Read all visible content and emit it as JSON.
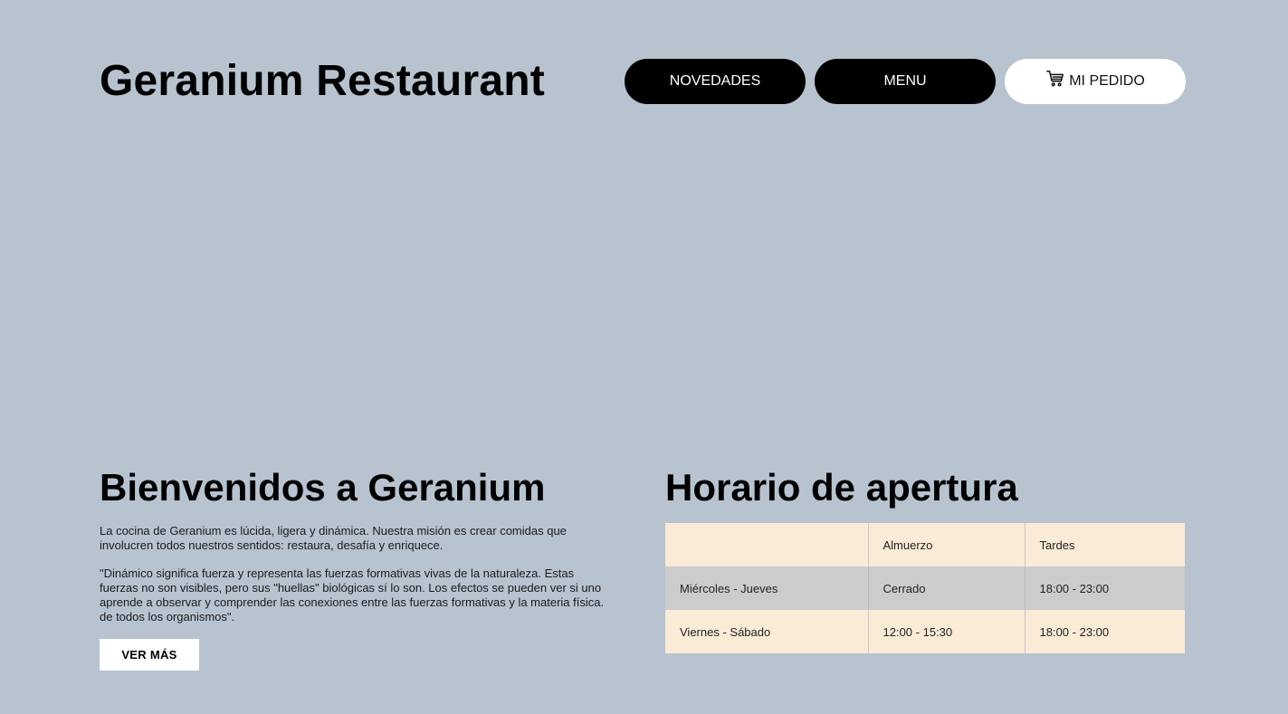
{
  "header": {
    "title": "Geranium Restaurant",
    "nav": {
      "news_label": "NOVEDADES",
      "menu_label": "MENU",
      "order_label": "MI PEDIDO",
      "order_icon": "cart-icon"
    }
  },
  "welcome": {
    "title": "Bienvenidos a Geranium",
    "paragraph1": "La cocina de Geranium es lúcida, ligera y dinámica. Nuestra misión es crear comidas que involucren todos nuestros sentidos: restaura, desafía y enriquece.",
    "paragraph2": "\"Dinámico significa fuerza y representa las fuerzas formativas vivas de la naturaleza. Estas fuerzas no son visibles, pero sus \"huellas\" biológicas sí lo son. Los efectos se pueden ver si uno aprende a observar y comprender las conexiones entre las fuerzas formativas y la materia física. de todos los organismos\".",
    "more_label": "VER MÁS"
  },
  "hours": {
    "title": "Horario de apertura",
    "headers": [
      "",
      "Almuerzo",
      "Tardes"
    ],
    "rows": [
      [
        "Miércoles - Jueves",
        "Cerrado",
        "18:00 - 23:00"
      ],
      [
        "Viernes - Sábado",
        "12:00 - 15:30",
        "18:00 - 23:00"
      ]
    ]
  },
  "colors": {
    "background": "#b7c3cf",
    "table_light": "#faebd7",
    "table_alt": "#cccccc"
  }
}
